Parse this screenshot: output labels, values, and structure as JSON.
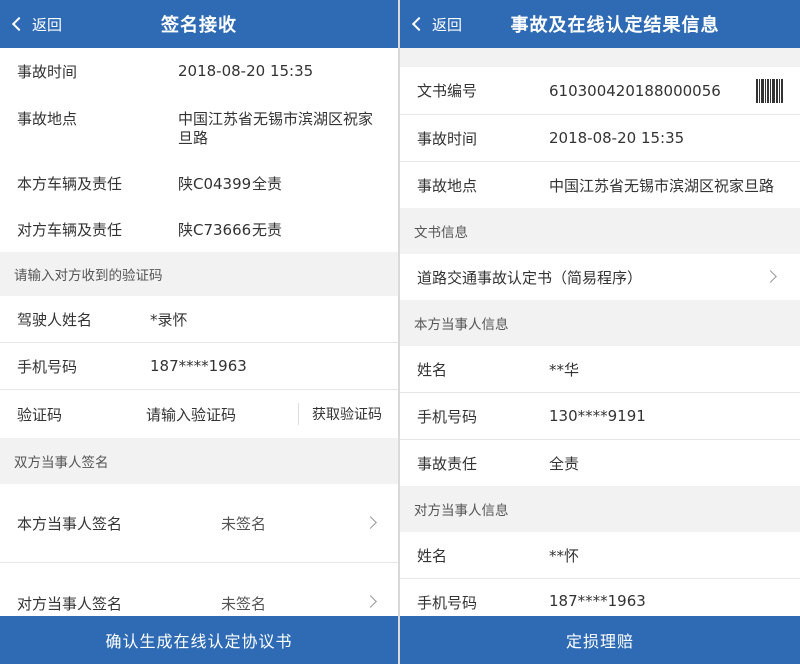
{
  "left": {
    "header": {
      "back_label": "返回",
      "title": "签名接收"
    },
    "accident_time": {
      "label": "事故时间",
      "value": "2018-08-20 15:35"
    },
    "accident_place": {
      "label": "事故地点",
      "value_line1": "中国江苏省无锡市滨湖区祝家",
      "value_line2": "旦路"
    },
    "own_vehicle": {
      "label": "本方车辆及责任",
      "plate": "陕C04399",
      "liability": "全责"
    },
    "other_vehicle": {
      "label": "对方车辆及责任",
      "plate": "陕C73666",
      "liability": "无责"
    },
    "verify_section": "请输入对方收到的验证码",
    "driver_name": {
      "label": "驾驶人姓名",
      "value": "*录怀"
    },
    "phone": {
      "label": "手机号码",
      "value": "187****1963"
    },
    "code": {
      "label": "验证码",
      "placeholder": "请输入验证码",
      "get_code": "获取验证码"
    },
    "sign_section": "双方当事人签名",
    "own_sign": {
      "label": "本方当事人签名",
      "status": "未签名"
    },
    "other_sign": {
      "label": "对方当事人签名",
      "status": "未签名"
    },
    "bottom_button": "确认生成在线认定协议书"
  },
  "right": {
    "header": {
      "back_label": "返回",
      "title": "事故及在线认定结果信息"
    },
    "doc_no": {
      "label": "文书编号",
      "value": "610300420188000056"
    },
    "accident_time": {
      "label": "事故时间",
      "value": "2018-08-20 15:35"
    },
    "accident_place": {
      "label": "事故地点",
      "value": "中国江苏省无锡市滨湖区祝家旦路"
    },
    "doc_section": "文书信息",
    "doc_item": "道路交通事故认定书（简易程序）",
    "own_party_section": "本方当事人信息",
    "own_name": {
      "label": "姓名",
      "value": "**华"
    },
    "own_phone": {
      "label": "手机号码",
      "value": "130****9191"
    },
    "own_liability": {
      "label": "事故责任",
      "value": "全责"
    },
    "other_party_section": "对方当事人信息",
    "other_name": {
      "label": "姓名",
      "value": "**怀"
    },
    "other_phone": {
      "label": "手机号码",
      "value": "187****1963"
    },
    "bottom_button": "定损理赔"
  },
  "colors": {
    "header": "#2e6bb4",
    "danger": "#e53935",
    "success": "#22b14c",
    "link": "#2e6bb4"
  },
  "icons": [
    "back-chevron-icon",
    "chevron-right-icon",
    "barcode-icon"
  ]
}
